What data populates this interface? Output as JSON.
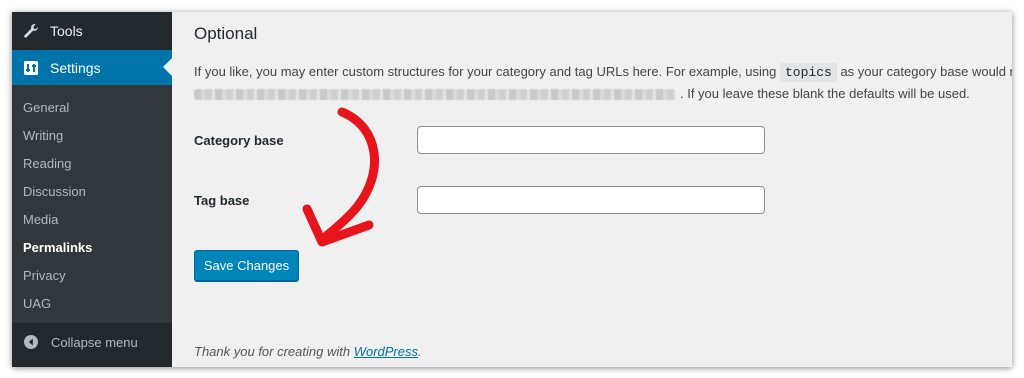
{
  "sidebar": {
    "tools_label": "Tools",
    "settings_label": "Settings",
    "submenu": [
      "General",
      "Writing",
      "Reading",
      "Discussion",
      "Media",
      "Permalinks",
      "Privacy",
      "UAG"
    ],
    "current": "Permalinks",
    "collapse_label": "Collapse menu"
  },
  "main": {
    "section_title": "Optional",
    "description_part1": "If you like, you may enter custom structures for your category and tag URLs here. For example, using",
    "description_code": "topics",
    "description_part2": "as your category base would r",
    "description_part3": ". If you leave these blank the defaults will be used.",
    "category_base_label": "Category base",
    "category_base_value": "",
    "tag_base_label": "Tag base",
    "tag_base_value": "",
    "save_button_label": "Save Changes",
    "footer_text": "Thank you for creating with",
    "footer_link": "WordPress",
    "footer_end": "."
  },
  "colors": {
    "admin_bar": "#23282d",
    "submenu_bg": "#32373c",
    "accent": "#0073aa",
    "button": "#0085ba",
    "annotation_arrow": "#e8141b"
  },
  "icons": {
    "tools": "wrench-icon",
    "settings": "settings-icon",
    "collapse": "collapse-icon"
  }
}
